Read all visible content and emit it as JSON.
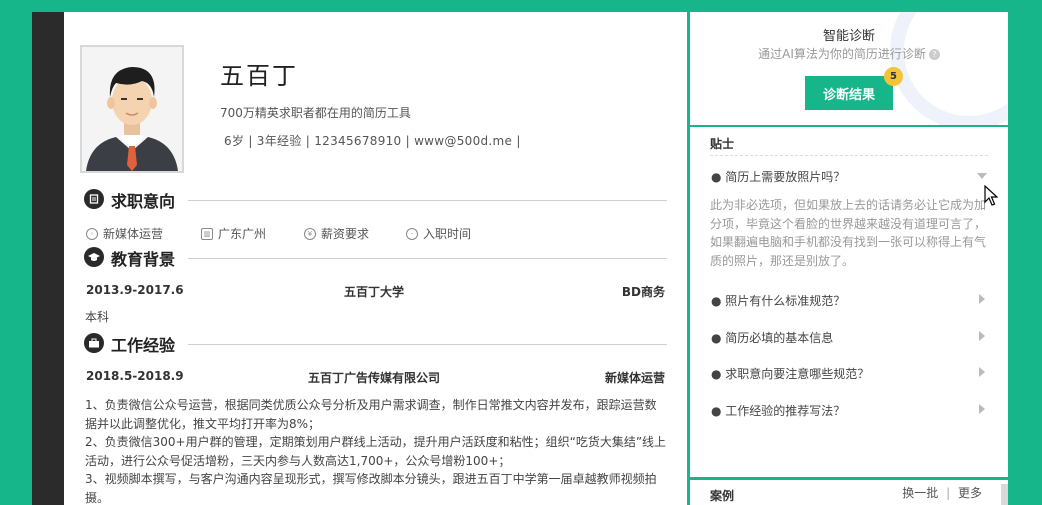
{
  "resume": {
    "name": "五百丁",
    "tagline": "700万精英求职者都在用的简历工具",
    "info_line": "6岁 | 3年经验 | 12345678910 | www@500d.me |",
    "sections": {
      "intent_title": "求职意向",
      "education_title": "教育背景",
      "work_title": "工作经验"
    },
    "intent": {
      "position": "新媒体运营",
      "city": "广东广州",
      "salary": "薪资要求",
      "start": "入职时间"
    },
    "education": {
      "period": "2013.9-2017.6",
      "school": "五百丁大学",
      "major": "BD商务",
      "degree": "本科"
    },
    "work": {
      "period": "2018.5-2018.9",
      "company": "五百丁广告传媒有限公司",
      "role": "新媒体运营",
      "line1": "1、负责微信公众号运营，根据同类优质公众号分析及用户需求调查，制作日常推文内容并发布，跟踪运营数据并以此调整优化，推文平均打开率为8%；",
      "line2": "2、负责微信300+用户群的管理，定期策划用户群线上活动，提升用户活跃度和粘性；组织“吃货大集结”线上活动，进行公众号促活增粉，三天内参与人数高达1,700+，公众号增粉100+；",
      "line3": "3、视频脚本撰写，与客户沟通内容呈现形式，撰写修改脚本分镜头，跟进五百丁中学第一届卓越教师视频拍摄。"
    }
  },
  "diagnosis": {
    "title": "智能诊断",
    "subtitle": "通过AI算法为你的简历进行诊断",
    "help_glyph": "?",
    "button_label": "诊断结果",
    "badge_count": "5"
  },
  "tips": {
    "heading": "贴士",
    "items": [
      {
        "label": "● 简历上需要放照片吗？"
      },
      {
        "label": "● 照片有什么标准规范？"
      },
      {
        "label": "● 简历必填的基本信息"
      },
      {
        "label": "● 求职意向要注意哪些规范？"
      },
      {
        "label": "● 工作经验的推荐写法？"
      }
    ],
    "answer": "此为非必选项，但如果放上去的话请务必让它成为加分项，毕竟这个看脸的世界越来越没有道理可言了，如果翻遍电脑和手机都没有找到一张可以称得上有气质的照片，那还是别放了。"
  },
  "cases": {
    "heading": "案例",
    "swap_label": "换一批",
    "separator": "|",
    "more_label": "更多"
  },
  "colors": {
    "accent": "#16b68a",
    "badge": "#f4c338",
    "sidebar_dark": "#2b2b2b"
  }
}
